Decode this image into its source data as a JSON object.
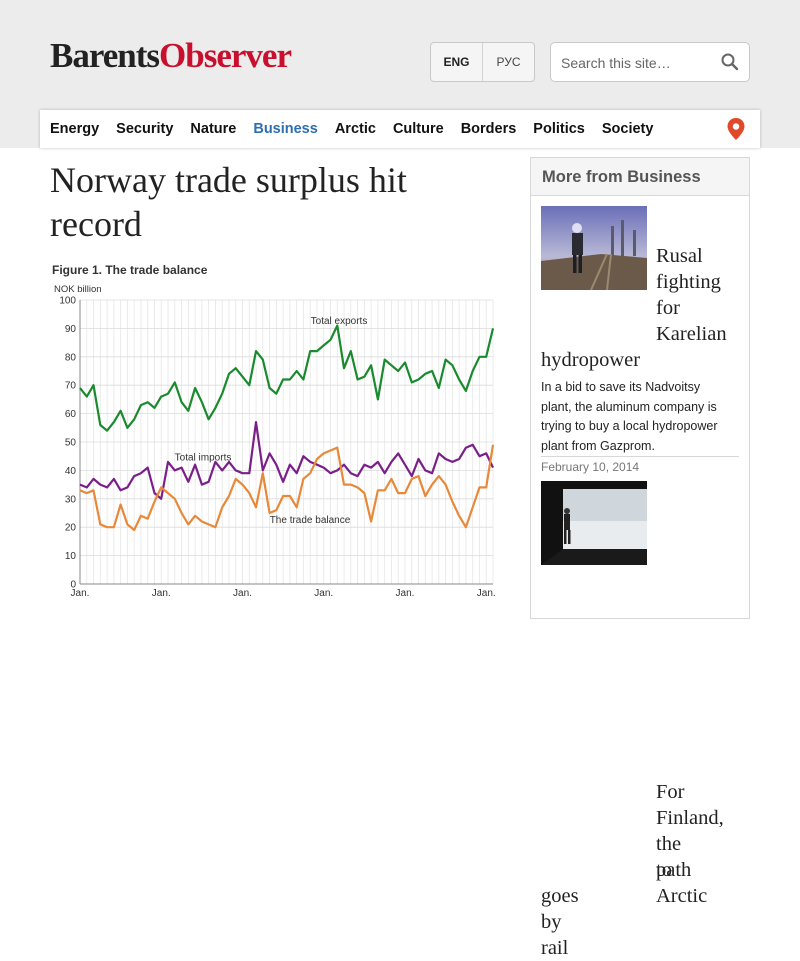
{
  "site": {
    "logo_part1": "Barents",
    "logo_part2": "Observer"
  },
  "header": {
    "lang_en": "ENG",
    "lang_ru": "РУС",
    "search_placeholder": "Search this site…"
  },
  "nav": {
    "items": [
      "Energy",
      "Security",
      "Nature",
      "Business",
      "Arctic",
      "Culture",
      "Borders",
      "Politics",
      "Society"
    ],
    "active": "Business"
  },
  "article": {
    "title": "Norway trade surplus hit record"
  },
  "sidebar": {
    "heading": "More from Business",
    "articles": [
      {
        "title": "Rusal fighting for Karelian hydropower",
        "title_lines": [
          "Rusal",
          "fighting",
          "for",
          "Karelian",
          "hydropower"
        ],
        "desc_lines": [
          "In a bid to save its Nadvoitsy",
          "plant, the aluminum company is",
          "trying to buy a local hydropower",
          "plant from Gazprom."
        ],
        "date": "February 10, 2014"
      },
      {
        "title": "For Finland, the path to Arctic goes by rail",
        "title_lines": [
          "For",
          "Finland,",
          "the path",
          "to Arctic",
          "goes by rail"
        ]
      }
    ]
  },
  "chart_data": {
    "type": "line",
    "title": "Figure 1. The trade balance",
    "ylabel": "NOK billion",
    "ylim": [
      0,
      100
    ],
    "yticks": [
      0,
      10,
      20,
      30,
      40,
      50,
      60,
      70,
      80,
      90,
      100
    ],
    "x_tick_labels": [
      "Jan.",
      "Jan.",
      "Jan.",
      "Jan.",
      "Jan.",
      "Jan."
    ],
    "grid": true,
    "series": [
      {
        "name": "Total exports",
        "color": "#1a8a2e",
        "values": [
          69,
          66,
          70,
          56,
          54,
          57,
          61,
          55,
          58,
          63,
          64,
          62,
          66,
          67,
          71,
          64,
          61,
          69,
          64,
          58,
          62,
          67,
          74,
          76,
          73,
          70,
          82,
          79,
          69,
          67,
          72,
          72,
          75,
          72,
          82,
          82,
          84,
          86,
          91,
          76,
          82,
          72,
          73,
          77,
          65,
          79,
          77,
          75,
          78,
          71,
          72,
          74,
          75,
          69,
          79,
          77,
          72,
          68,
          75,
          80,
          80,
          90
        ]
      },
      {
        "name": "Total imports",
        "color": "#7a1f8a",
        "values": [
          35,
          34,
          37,
          35,
          34,
          37,
          33,
          34,
          38,
          39,
          41,
          32,
          30,
          43,
          40,
          41,
          36,
          42,
          35,
          36,
          43,
          40,
          43,
          40,
          39,
          39,
          57,
          40,
          46,
          42,
          36,
          42,
          39,
          45,
          43,
          42,
          41,
          39,
          40,
          42,
          39,
          38,
          42,
          41,
          43,
          39,
          43,
          46,
          42,
          38,
          44,
          40,
          39,
          46,
          44,
          43,
          44,
          48,
          49,
          45,
          46,
          41
        ]
      },
      {
        "name": "The trade balance",
        "color": "#e8893a",
        "values": [
          33,
          32,
          33,
          21,
          20,
          20,
          28,
          21,
          19,
          24,
          23,
          29,
          34,
          32,
          30,
          25,
          21,
          24,
          22,
          21,
          20,
          27,
          31,
          37,
          35,
          32,
          27,
          39,
          25,
          26,
          31,
          31,
          27,
          37,
          39,
          44,
          46,
          47,
          48,
          35,
          35,
          34,
          32,
          22,
          33,
          33,
          37,
          32,
          32,
          37,
          38,
          31,
          35,
          38,
          35,
          29,
          24,
          20,
          27,
          34,
          34,
          49
        ]
      }
    ],
    "annotations": [
      "Total exports",
      "Total imports",
      "The trade balance"
    ]
  }
}
